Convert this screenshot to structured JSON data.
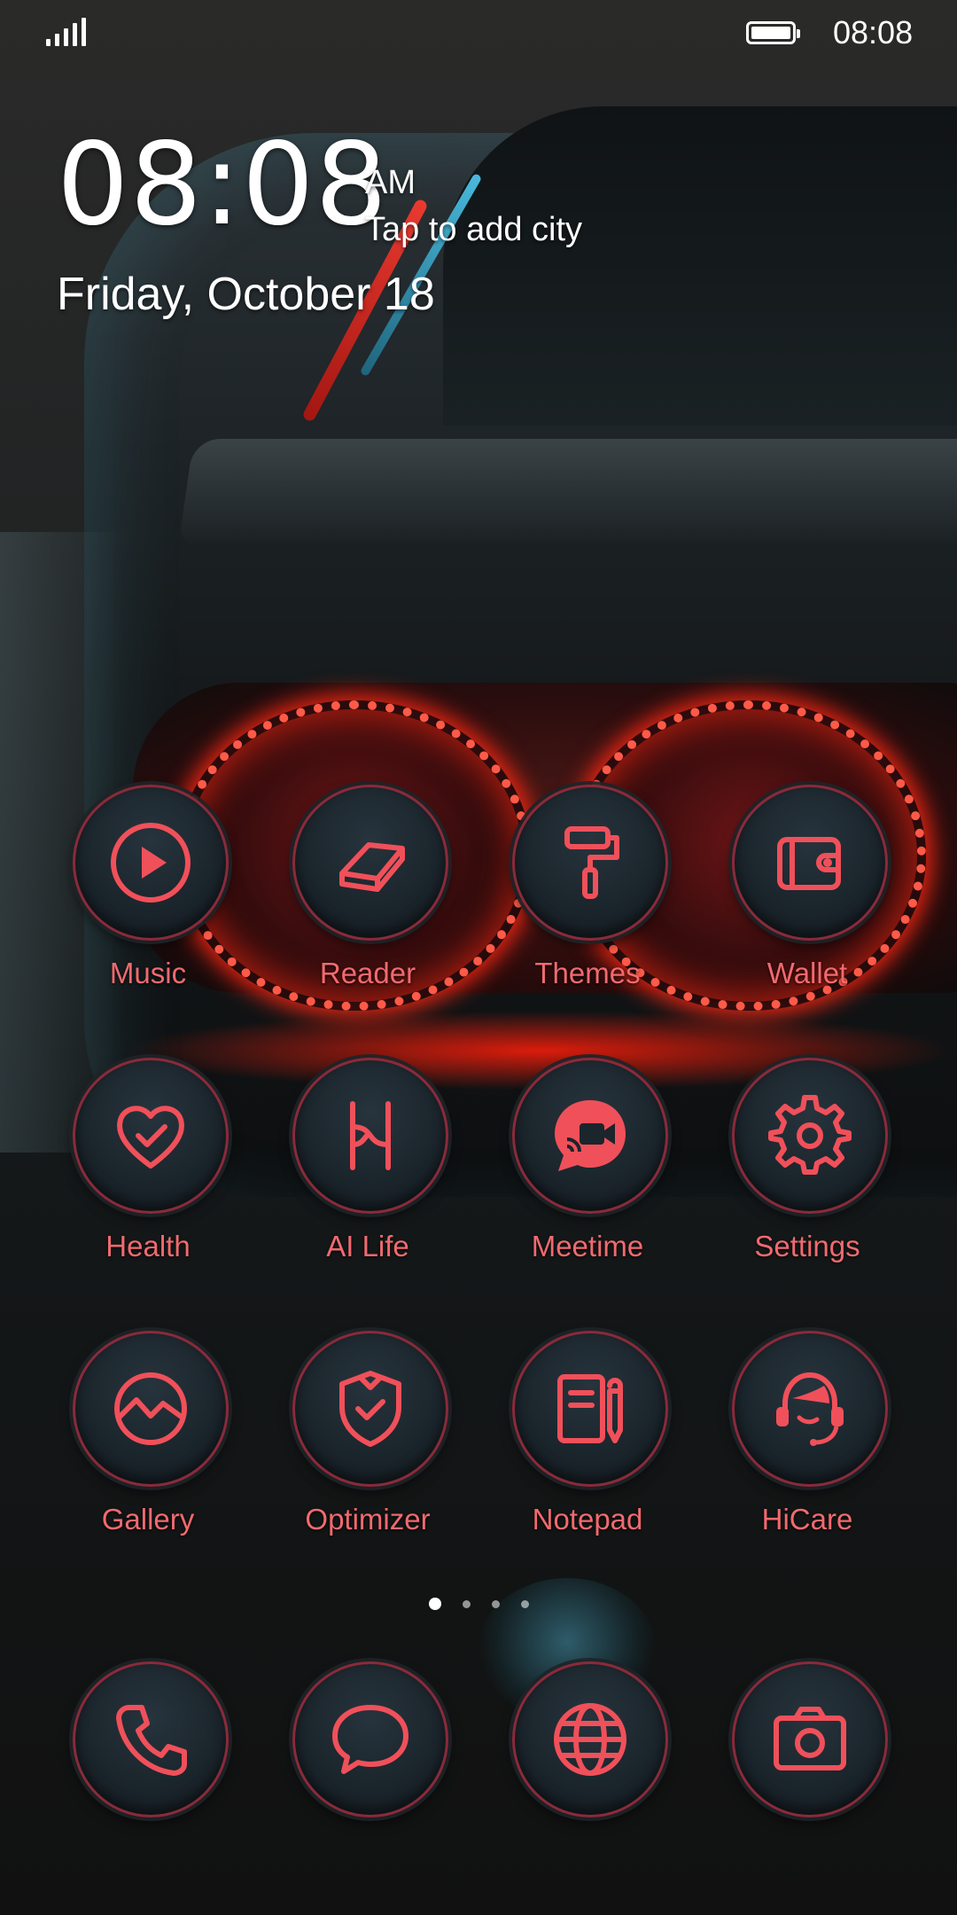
{
  "status_bar": {
    "time": "08:08",
    "signal_icon": "signal-icon",
    "battery_icon": "battery-icon"
  },
  "clock_widget": {
    "time": "08:08",
    "ampm": "AM",
    "city_prompt": "Tap to add city",
    "date": "Friday, October 18"
  },
  "apps": [
    {
      "label": "Music",
      "icon": "play-icon"
    },
    {
      "label": "Reader",
      "icon": "book-icon"
    },
    {
      "label": "Themes",
      "icon": "paint-roller-icon"
    },
    {
      "label": "Wallet",
      "icon": "wallet-icon"
    },
    {
      "label": "Health",
      "icon": "heart-check-icon"
    },
    {
      "label": "AI Life",
      "icon": "ai-life-icon"
    },
    {
      "label": "Meetime",
      "icon": "video-chat-icon"
    },
    {
      "label": "Settings",
      "icon": "gear-icon"
    },
    {
      "label": "Gallery",
      "icon": "gallery-icon"
    },
    {
      "label": "Optimizer",
      "icon": "shield-check-icon"
    },
    {
      "label": "Notepad",
      "icon": "notepad-icon"
    },
    {
      "label": "HiCare",
      "icon": "headset-icon"
    }
  ],
  "page_indicator": {
    "total": 4,
    "current": 1
  },
  "dock": [
    {
      "icon": "phone-icon"
    },
    {
      "icon": "message-icon"
    },
    {
      "icon": "globe-icon"
    },
    {
      "icon": "camera-icon"
    }
  ],
  "colors": {
    "accent": "#f0505a",
    "label": "#f06a6f"
  }
}
